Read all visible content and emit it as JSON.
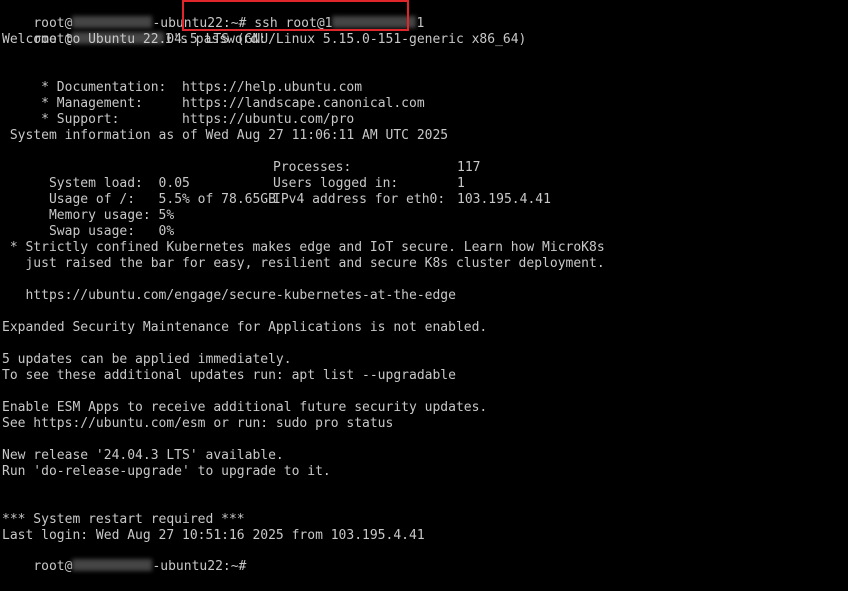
{
  "colors": {
    "background": "#000000",
    "text": "#c8c8c8",
    "redaction": "#6a6a6a",
    "highlight_border": "#e0262b"
  },
  "terminal": {
    "prompt1": {
      "user": "root@",
      "host_suffix": "-ubuntu22:~# ",
      "command_prefix": "ssh root@1",
      "command_suffix": "1"
    },
    "password_line": {
      "prefix": "root@",
      "suffix": "1's password:"
    },
    "welcome": "Welcome to Ubuntu 22.04.5 LTS (GNU/Linux 5.15.0-151-generic x86_64)",
    "links": {
      "documentation": {
        "label": " * Documentation:  ",
        "url": "https://help.ubuntu.com"
      },
      "management": {
        "label": " * Management:     ",
        "url": "https://landscape.canonical.com"
      },
      "support": {
        "label": " * Support:        ",
        "url": "https://ubuntu.com/pro"
      }
    },
    "sysinfo_header": " System information as of Wed Aug 27 11:06:11 AM UTC 2025",
    "stats": {
      "system_load": {
        "label": "  System load:  ",
        "value": "0.05"
      },
      "usage": {
        "label": "  Usage of /:   ",
        "value": "5.5% of 78.65GB"
      },
      "memory": {
        "label": "  Memory usage: ",
        "value": "5%"
      },
      "swap": {
        "label": "  Swap usage:   ",
        "value": "0%"
      },
      "processes": {
        "label": "Processes:",
        "value": "117"
      },
      "users": {
        "label": "Users logged in:",
        "value": "1"
      },
      "ipv4": {
        "label": "IPv4 address for eth0:",
        "value": "103.195.4.41"
      }
    },
    "k8s_line1": " * Strictly confined Kubernetes makes edge and IoT secure. Learn how MicroK8s",
    "k8s_line2": "   just raised the bar for easy, resilient and secure K8s cluster deployment.",
    "k8s_url": "   https://ubuntu.com/engage/secure-kubernetes-at-the-edge",
    "esm_status": "Expanded Security Maintenance for Applications is not enabled.",
    "updates_line1": "5 updates can be applied immediately.",
    "updates_line2": "To see these additional updates run: apt list --upgradable",
    "esm_line1": "Enable ESM Apps to receive additional future security updates.",
    "esm_line2": "See https://ubuntu.com/esm or run: sudo pro status",
    "release_line1": "New release '24.04.3 LTS' available.",
    "release_line2": "Run 'do-release-upgrade' to upgrade to it.",
    "restart_required": "*** System restart required ***",
    "last_login": "Last login: Wed Aug 27 10:51:16 2025 from 103.195.4.41",
    "prompt2": {
      "user": "root@",
      "host_suffix": "-ubuntu22:~# "
    }
  }
}
